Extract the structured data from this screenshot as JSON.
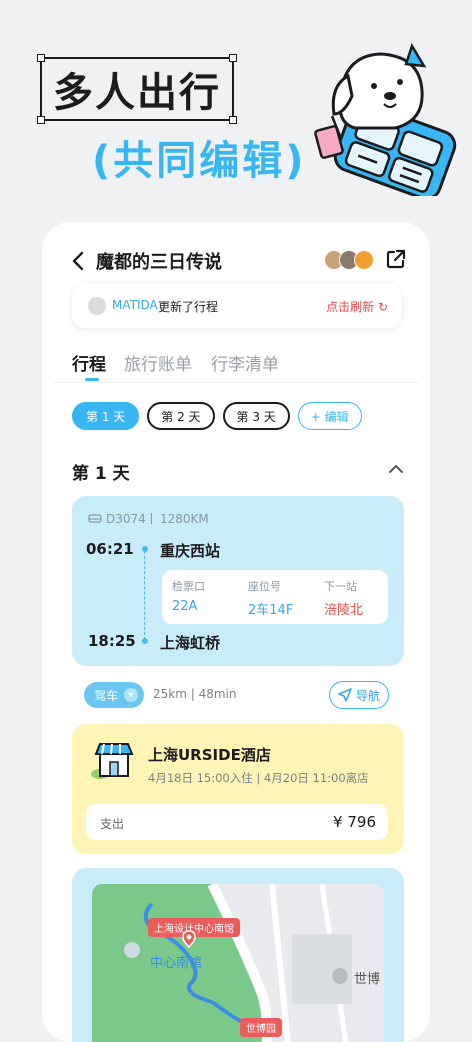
{
  "promo": {
    "title": "多人出行",
    "subtitle": "(共同编辑)"
  },
  "header": {
    "title": "魔都的三日传说"
  },
  "notice": {
    "user": "MATIDA",
    "text": "更新了行程",
    "refresh": "点击刷新 ↻"
  },
  "tabs": [
    {
      "label": "行程",
      "active": true
    },
    {
      "label": "旅行账单",
      "active": false
    },
    {
      "label": "行李清单",
      "active": false
    }
  ],
  "days": [
    {
      "label": "第 1 天",
      "active": true
    },
    {
      "label": "第 2 天",
      "active": false
    },
    {
      "label": "第 3 天",
      "active": false
    }
  ],
  "edit_label": "+ 编辑",
  "day_title": "第 1 天",
  "train": {
    "code": "D3074",
    "distance": "1280KM",
    "departure_time": "06:21",
    "departure_station": "重庆西站",
    "arrival_time": "18:25",
    "arrival_station": "上海虹桥",
    "info": [
      {
        "label": "检票口",
        "value": "22A"
      },
      {
        "label": "座位号",
        "value": "2车14F"
      },
      {
        "label": "下一站",
        "value": "涪陵北"
      }
    ]
  },
  "drive": {
    "label": "驾车",
    "info": "25km | 48min",
    "nav_label": "导航"
  },
  "hotel": {
    "name": "上海URSIDE酒店",
    "dates": "4月18日 15:00入住  |  4月20日 11:00离店",
    "pay_label": "支出",
    "pay_amount": "¥ 796"
  },
  "map": {
    "labels": [
      "上海设计中心南馆",
      "中心南馆",
      "世博",
      "世博园"
    ]
  },
  "colors": {
    "accent": "#38b6f3",
    "train_bg": "#c9ecfb",
    "hotel_bg": "#fdf4b5",
    "danger": "#e64a4a"
  }
}
